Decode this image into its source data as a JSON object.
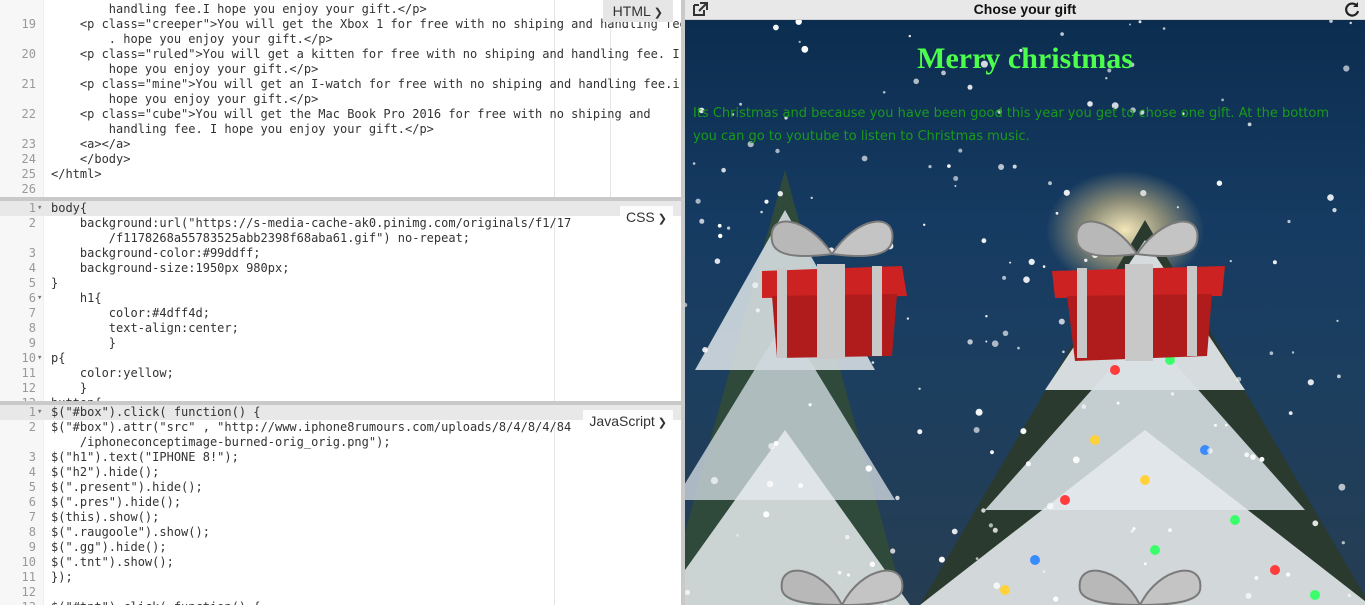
{
  "editor": {
    "html_mode": "HTML",
    "css_mode": "CSS",
    "js_mode": "JavaScript"
  },
  "html_lines": [
    {
      "n": "",
      "t": "        handling fee.I hope you enjoy your gift.</p>"
    },
    {
      "n": "19",
      "t": "    <p class=\"creeper\">You will get the Xbox 1 for free with no shiping and handling fee"
    },
    {
      "n": "",
      "t": "        . hope you enjoy your gift.</p>"
    },
    {
      "n": "20",
      "t": "    <p class=\"ruled\">You will get a kitten for free with no shiping and handling fee. I"
    },
    {
      "n": "",
      "t": "        hope you enjoy your gift.</p>"
    },
    {
      "n": "21",
      "t": "    <p class=\"mine\">You will get an I-watch for free with no shiping and handling fee.i"
    },
    {
      "n": "",
      "t": "        hope you enjoy your gift.</p>"
    },
    {
      "n": "22",
      "t": "    <p class=\"cube\">You will get the Mac Book Pro 2016 for free with no shiping and"
    },
    {
      "n": "",
      "t": "        handling fee. I hope you enjoy your gift.</p>"
    },
    {
      "n": "23",
      "t": "    <a></a>"
    },
    {
      "n": "24",
      "t": "    </body>"
    },
    {
      "n": "25",
      "t": "</html>"
    },
    {
      "n": "26",
      "t": ""
    }
  ],
  "css_lines": [
    {
      "n": "1",
      "f": "▾",
      "t": "body{"
    },
    {
      "n": "2",
      "t": "    background:url(\"https://s-media-cache-ak0.pinimg.com/originals/f1/17"
    },
    {
      "n": "",
      "t": "        /f1178268a55783525abb2398f68aba61.gif\") no-repeat;"
    },
    {
      "n": "3",
      "t": "    background-color:#99ddff;"
    },
    {
      "n": "4",
      "t": "    background-size:1950px 980px;"
    },
    {
      "n": "5",
      "t": "}"
    },
    {
      "n": "6",
      "f": "▾",
      "t": "    h1{"
    },
    {
      "n": "7",
      "t": "        color:#4dff4d;"
    },
    {
      "n": "8",
      "t": "        text-align:center;"
    },
    {
      "n": "9",
      "t": "        }"
    },
    {
      "n": "10",
      "f": "▾",
      "t": "p{"
    },
    {
      "n": "11",
      "t": "    color:yellow;"
    },
    {
      "n": "12",
      "t": "    }"
    },
    {
      "n": "13",
      "t": "button{"
    }
  ],
  "js_lines": [
    {
      "n": "1",
      "f": "▾",
      "t": "$(\"#box\").click( function() {"
    },
    {
      "n": "2",
      "t": "$(\"#box\").attr(\"src\" , \"http://www.iphone8rumours.com/uploads/8/4/8/4/84"
    },
    {
      "n": "",
      "t": "    /iphoneconceptimage-burned-orig_orig.png\");"
    },
    {
      "n": "3",
      "t": "$(\"h1\").text(\"IPHONE 8!\");"
    },
    {
      "n": "4",
      "t": "$(\"h2\").hide();"
    },
    {
      "n": "5",
      "t": "$(\".present\").hide();"
    },
    {
      "n": "6",
      "t": "$(\".pres\").hide();"
    },
    {
      "n": "7",
      "t": "$(this).show();"
    },
    {
      "n": "8",
      "t": "$(\".raugoole\").show();"
    },
    {
      "n": "9",
      "t": "$(\".gg\").hide();"
    },
    {
      "n": "10",
      "t": "$(\".tnt\").show();"
    },
    {
      "n": "11",
      "t": "});"
    },
    {
      "n": "12",
      "t": ""
    },
    {
      "n": "13",
      "t": "$(\"#tnt\").click( function() {"
    }
  ],
  "preview": {
    "title": "Chose your gift",
    "heading": "Merry christmas",
    "paragraph": "Its Christmas and because you have been good this year you get to chose one gift. At the bottom you can go to youtube to listen to Christmas music.",
    "heading_color": "#4dff4d",
    "paragraph_color": "#1a9a1a",
    "open_icon": "external-link-icon",
    "refresh_icon": "refresh-icon"
  }
}
